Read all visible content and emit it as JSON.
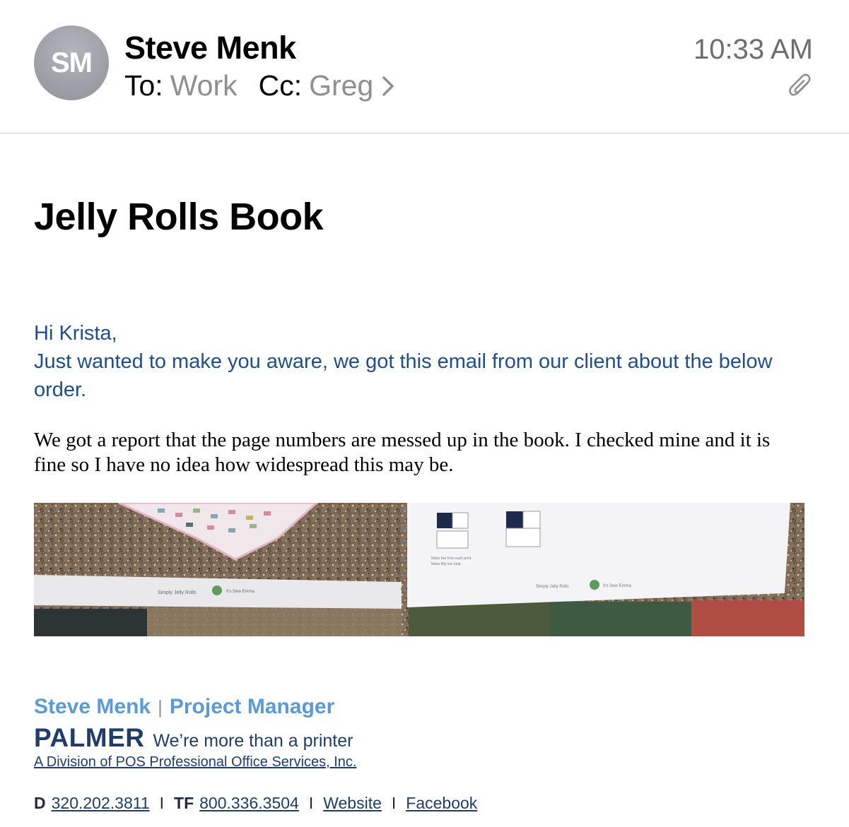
{
  "header": {
    "avatar_initials": "SM",
    "sender_name": "Steve Menk",
    "to_label": "To:",
    "to_value": "Work",
    "cc_label": "Cc:",
    "cc_value": "Greg",
    "time": "10:33 AM",
    "attachment_icon": "paperclip-icon",
    "expand_icon": "chevron-right-icon"
  },
  "email": {
    "subject": "Jelly Rolls Book",
    "intro_line1": "Hi Krista,",
    "intro_line2": "Just wanted to make you aware, we got this email from our client about the below order.",
    "client_message": "We got a report that the page numbers are messed up in the book. I checked mine and it is fine so I have no idea how widespread this may be.",
    "photo_texts": {
      "left_footer": "Simply Jelly Rolls",
      "left_footer_right": "It's Sew Emma",
      "right_footer": "Simply Jelly Rolls",
      "right_footer_right": "It's Sew Emma",
      "instruction_1": "Make two from each print.",
      "instruction_2": "Make fifty two total."
    }
  },
  "signature": {
    "name": "Steve Menk",
    "separator": "|",
    "title": "Project Manager",
    "company": "PALMER",
    "tagline": "We’re more than a printer",
    "division": "A Division of POS Professional Office Services, Inc.",
    "direct_label": "D",
    "direct_phone": "320.202.3811",
    "tollfree_label": "TF",
    "tollfree_phone": "800.336.3504",
    "website_label": "Website",
    "facebook_label": "Facebook",
    "contact_separator": "I"
  },
  "colors": {
    "intro_text": "#1f4e8c",
    "signature_name": "#5b9bd5",
    "signature_dark": "#1f3d6b",
    "muted": "#8e8e93"
  }
}
